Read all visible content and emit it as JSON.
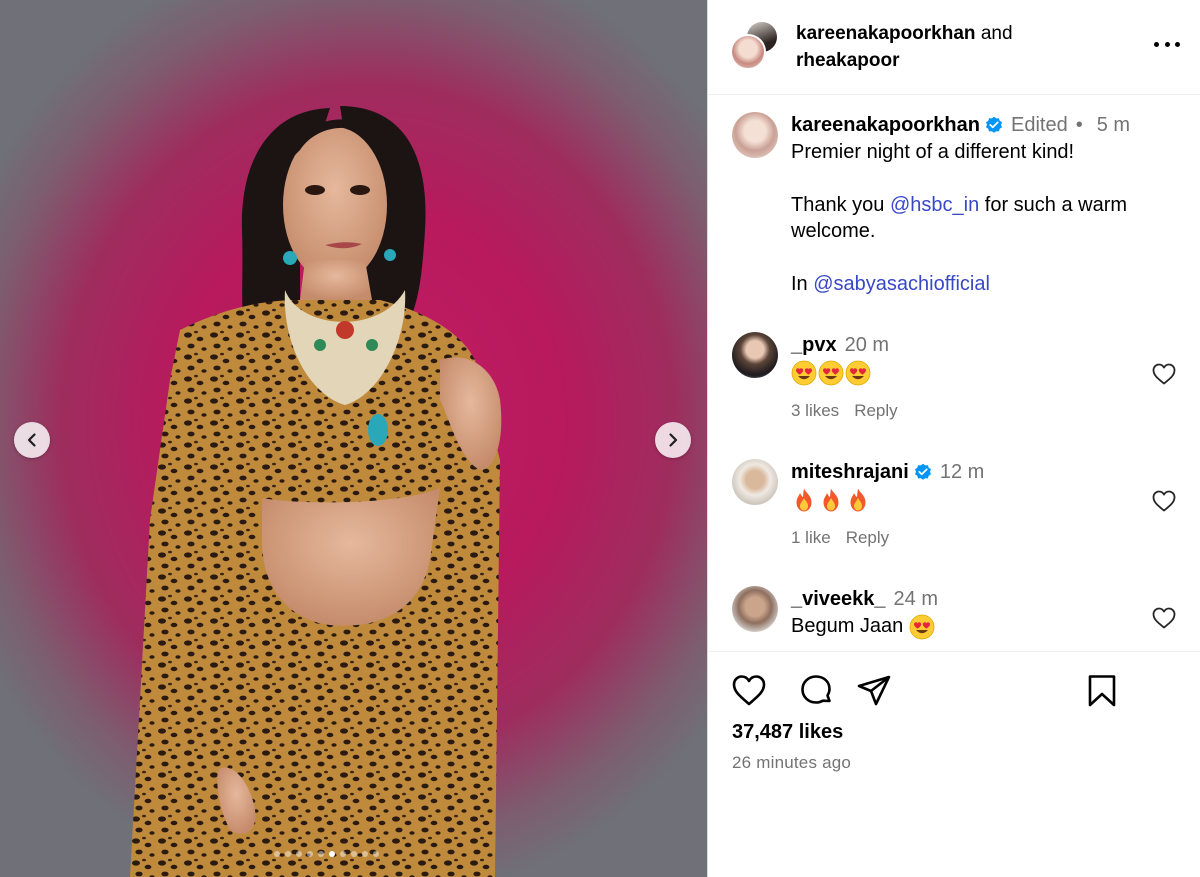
{
  "header": {
    "user_a": "kareenakapoorkhan",
    "connector": "and",
    "user_b": "rheakapoor"
  },
  "caption": {
    "username": "kareenakapoorkhan",
    "edited": "Edited",
    "separator": "•",
    "time": "5 m",
    "line1": "Premier night of a different kind!",
    "line2_pre": "Thank you ",
    "line2_mention": "@hsbc_in",
    "line2_post": " for such a warm welcome.",
    "line3_pre": "In ",
    "line3_mention": "@sabyasachiofficial"
  },
  "comments": [
    {
      "username": "_pvx",
      "time": "20 m",
      "text": "",
      "emoji": [
        "heart-eyes",
        "heart-eyes",
        "heart-eyes"
      ],
      "likes": "3 likes",
      "reply": "Reply",
      "verified": false
    },
    {
      "username": "miteshrajani",
      "time": "12 m",
      "text": "",
      "emoji": [
        "fire",
        "fire",
        "fire"
      ],
      "likes": "1 like",
      "reply": "Reply",
      "verified": true
    },
    {
      "username": "_viveekk_",
      "time": "24 m",
      "text": "Begum Jaan ",
      "emoji": [
        "heart-eyes"
      ],
      "likes": "",
      "reply": "",
      "verified": false
    }
  ],
  "footer": {
    "likes": "37,487 likes",
    "time": "26 minutes ago"
  },
  "carousel": {
    "total": 10,
    "active_index": 5
  },
  "colors": {
    "verified": "#0095f6",
    "mention": "#3848c8",
    "muted": "#737373",
    "backdrop": "#c41c63"
  }
}
